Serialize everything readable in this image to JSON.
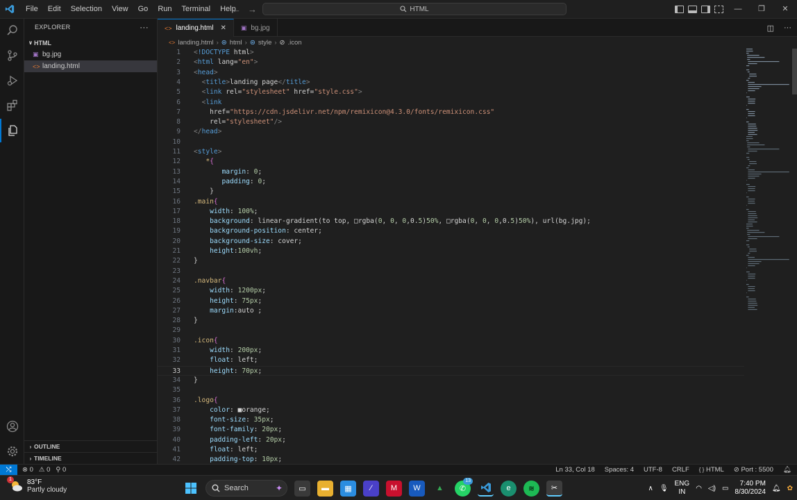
{
  "menu": [
    "File",
    "Edit",
    "Selection",
    "View",
    "Go",
    "Run",
    "Terminal",
    "Help"
  ],
  "command_center": "HTML",
  "explorer": {
    "title": "EXPLORER",
    "more": "···",
    "folder": "HTML",
    "files": [
      {
        "name": "bg.jpg",
        "icon": "image-file-icon",
        "selected": false
      },
      {
        "name": "landing.html",
        "icon": "html-file-icon",
        "selected": true
      }
    ],
    "outline": "OUTLINE",
    "timeline": "TIMELINE"
  },
  "tabs": [
    {
      "label": "landing.html",
      "active": true,
      "close": "✕"
    },
    {
      "label": "bg.jpg",
      "active": false
    }
  ],
  "breadcrumb": [
    "landing.html",
    "html",
    "style",
    ".icon"
  ],
  "code": [
    {
      "n": "1",
      "t": "<!DOCTYPE html>"
    },
    {
      "n": "2",
      "t": "<html lang=\"en\">"
    },
    {
      "n": "3",
      "t": "<head>"
    },
    {
      "n": "4",
      "t": "  <title>landing page</title>"
    },
    {
      "n": "5",
      "t": "  <link rel=\"stylesheet\" href=\"style.css\">"
    },
    {
      "n": "6",
      "t": "  <link"
    },
    {
      "n": "7",
      "t": "    href=\"https://cdn.jsdelivr.net/npm/remixicon@4.3.0/fonts/remixicon.css\""
    },
    {
      "n": "8",
      "t": "    rel=\"stylesheet\"/>"
    },
    {
      "n": "9",
      "t": "</head>"
    },
    {
      "n": "10",
      "t": ""
    },
    {
      "n": "11",
      "t": "<style>"
    },
    {
      "n": "12",
      "t": "   *{"
    },
    {
      "n": "13",
      "t": "       margin: 0;"
    },
    {
      "n": "14",
      "t": "       padding: 0;"
    },
    {
      "n": "15",
      "t": "    }"
    },
    {
      "n": "16",
      "t": ".main{"
    },
    {
      "n": "17",
      "t": "    width: 100%;"
    },
    {
      "n": "18",
      "t": "    background: linear-gradient(to top, □rgba(0, 0, 0,0.5)50%, □rgba(0, 0, 0,0.5)50%), url(bg.jpg);"
    },
    {
      "n": "19",
      "t": "    background-position: center;"
    },
    {
      "n": "20",
      "t": "    background-size: cover;"
    },
    {
      "n": "21",
      "t": "    height:100vh;"
    },
    {
      "n": "22",
      "t": "}"
    },
    {
      "n": "23",
      "t": ""
    },
    {
      "n": "24",
      "t": ".navbar{"
    },
    {
      "n": "25",
      "t": "    width: 1200px;"
    },
    {
      "n": "26",
      "t": "    height: 75px;"
    },
    {
      "n": "27",
      "t": "    margin:auto ;"
    },
    {
      "n": "28",
      "t": "}"
    },
    {
      "n": "29",
      "t": ""
    },
    {
      "n": "30",
      "t": ".icon{"
    },
    {
      "n": "31",
      "t": "    width: 200px;"
    },
    {
      "n": "32",
      "t": "    float: left;"
    },
    {
      "n": "33",
      "t": "    height: 70px;"
    },
    {
      "n": "34",
      "t": "}"
    },
    {
      "n": "35",
      "t": ""
    },
    {
      "n": "36",
      "t": ".logo{"
    },
    {
      "n": "37",
      "t": "    color: ■orange;"
    },
    {
      "n": "38",
      "t": "    font-size: 35px;"
    },
    {
      "n": "39",
      "t": "    font-family: 20px;"
    },
    {
      "n": "40",
      "t": "    padding-left: 20px;"
    },
    {
      "n": "41",
      "t": "    float: left;"
    },
    {
      "n": "42",
      "t": "    padding-top: 10px;"
    }
  ],
  "current_line": "33",
  "status": {
    "errors": "0",
    "warnings": "0",
    "ports": "0",
    "position": "Ln 33, Col 18",
    "spaces": "Spaces: 4",
    "encoding": "UTF-8",
    "eol": "CRLF",
    "language": "HTML",
    "live_server": "Port : 5500"
  },
  "taskbar": {
    "weather_temp": "83°F",
    "weather_desc": "Partly cloudy",
    "weather_badge": "1",
    "search": "Search",
    "whatsapp_badge": "13",
    "lang_top": "ENG",
    "lang_bottom": "IN",
    "time": "7:40 PM",
    "date": "8/30/2024"
  },
  "colors": {
    "accent": "#0078d4",
    "keyword": "#569cd6",
    "string": "#ce9178",
    "property": "#9cdcfe",
    "selector": "#d7ba7d",
    "number": "#b5cea8"
  }
}
